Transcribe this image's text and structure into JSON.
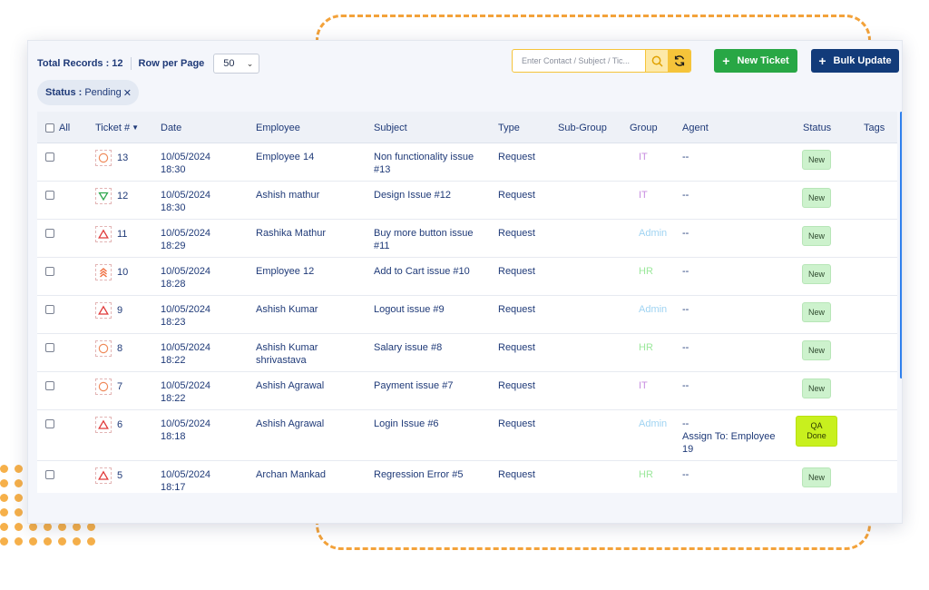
{
  "toolbar": {
    "total_label": "Total Records : 12",
    "rows_label": "Row per Page",
    "rows_value": "50",
    "search_placeholder": "Enter Contact / Subject / Tic...",
    "new_ticket": "New Ticket",
    "bulk_update": "Bulk Update"
  },
  "filter": {
    "key": "Status :",
    "value": "Pending"
  },
  "columns": {
    "all": "All",
    "ticket": "Ticket #",
    "date": "Date",
    "employee": "Employee",
    "subject": "Subject",
    "type": "Type",
    "subgroup": "Sub-Group",
    "group": "Group",
    "agent": "Agent",
    "status": "Status",
    "tags": "Tags"
  },
  "colors": {
    "IT": "#c88ee0",
    "Admin": "#9fd3f2",
    "HR": "#9be89b",
    "accent": "#f5c43a",
    "green": "#28a745",
    "navy": "#123b7a"
  },
  "rows": [
    {
      "priority": "circle",
      "ticket": "13",
      "date": "10/05/2024",
      "time": "18:30",
      "employee": [
        "Employee 14"
      ],
      "subject": [
        "Non functionality issue",
        "#13"
      ],
      "type": "Request",
      "group": "IT",
      "agent": [
        "--"
      ],
      "status": [
        "New"
      ]
    },
    {
      "priority": "down",
      "ticket": "12",
      "date": "10/05/2024",
      "time": "18:30",
      "employee": [
        "Ashish mathur"
      ],
      "subject": [
        "Design Issue #12"
      ],
      "type": "Request",
      "group": "IT",
      "agent": [
        "--"
      ],
      "status": [
        "New"
      ]
    },
    {
      "priority": "up",
      "ticket": "11",
      "date": "10/05/2024",
      "time": "18:29",
      "employee": [
        "Rashika Mathur"
      ],
      "subject": [
        "Buy more button issue",
        "#11"
      ],
      "type": "Request",
      "group": "Admin",
      "agent": [
        "--"
      ],
      "status": [
        "New"
      ]
    },
    {
      "priority": "double-up",
      "ticket": "10",
      "date": "10/05/2024",
      "time": "18:28",
      "employee": [
        "Employee 12"
      ],
      "subject": [
        "Add to Cart issue #10"
      ],
      "type": "Request",
      "group": "HR",
      "agent": [
        "--"
      ],
      "status": [
        "New"
      ]
    },
    {
      "priority": "up",
      "ticket": "9",
      "date": "10/05/2024",
      "time": "18:23",
      "employee": [
        "Ashish Kumar"
      ],
      "subject": [
        "Logout issue #9"
      ],
      "type": "Request",
      "group": "Admin",
      "agent": [
        "--"
      ],
      "status": [
        "New"
      ]
    },
    {
      "priority": "circle",
      "ticket": "8",
      "date": "10/05/2024",
      "time": "18:22",
      "employee": [
        "Ashish Kumar",
        "shrivastava"
      ],
      "subject": [
        "Salary issue #8"
      ],
      "type": "Request",
      "group": "HR",
      "agent": [
        "--"
      ],
      "status": [
        "New"
      ]
    },
    {
      "priority": "circle",
      "ticket": "7",
      "date": "10/05/2024",
      "time": "18:22",
      "employee": [
        "Ashish Agrawal"
      ],
      "subject": [
        "Payment issue #7"
      ],
      "type": "Request",
      "group": "IT",
      "agent": [
        "--"
      ],
      "status": [
        "New"
      ]
    },
    {
      "priority": "up",
      "ticket": "6",
      "date": "10/05/2024",
      "time": "18:18",
      "employee": [
        "Ashish Agrawal"
      ],
      "subject": [
        "Login Issue #6"
      ],
      "type": "Request",
      "group": "Admin",
      "agent": [
        "--",
        "Assign To: Employee",
        "19"
      ],
      "status": [
        "QA",
        "Done"
      ]
    },
    {
      "priority": "up",
      "ticket": "5",
      "date": "10/05/2024",
      "time": "18:17",
      "employee": [
        "Archan Mankad"
      ],
      "subject": [
        "Regression Error #5"
      ],
      "type": "Request",
      "group": "HR",
      "agent": [
        "--"
      ],
      "status": [
        "New"
      ]
    }
  ]
}
